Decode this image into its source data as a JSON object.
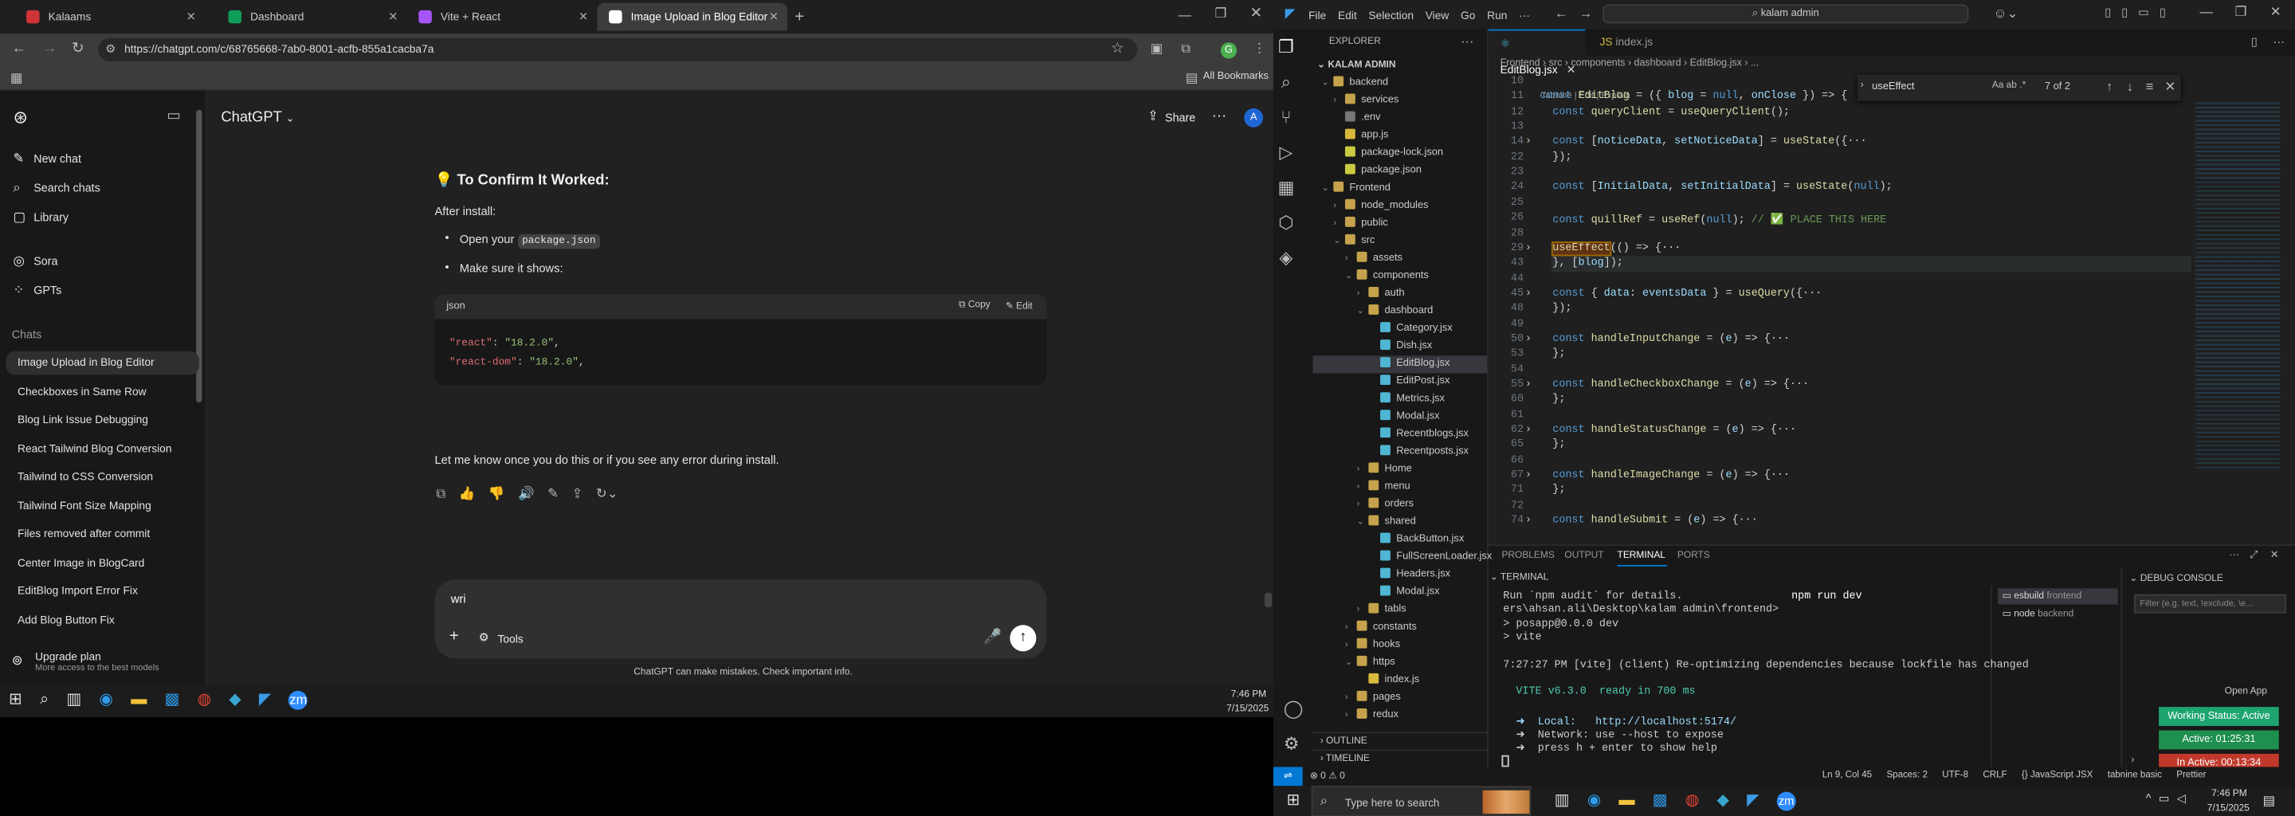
{
  "browser": {
    "tabs": [
      {
        "label": "Kalaams",
        "active": false,
        "color": "#d13438"
      },
      {
        "label": "Dashboard",
        "active": false,
        "color": "#0f9d58"
      },
      {
        "label": "Vite + React",
        "active": false,
        "color": "#a855f7"
      },
      {
        "label": "Image Upload in Blog Editor",
        "active": true,
        "color": "#ffffff"
      }
    ],
    "url": "https://chatgpt.com/c/68765668-7ab0-8001-acfb-855a1cacba7a",
    "all_bookmarks": "All Bookmarks",
    "profile_initial": "G"
  },
  "sidebar": {
    "new_chat": "New chat",
    "search_chats": "Search chats",
    "library": "Library",
    "sora": "Sora",
    "gpts": "GPTs",
    "chats_heading": "Chats",
    "chats": [
      "Image Upload in Blog Editor",
      "Checkboxes in Same Row",
      "Blog Link Issue Debugging",
      "React Tailwind Blog Conversion",
      "Tailwind to CSS Conversion",
      "Tailwind Font Size Mapping",
      "Files removed after commit",
      "Center Image in BlogCard",
      "EditBlog Import Error Fix",
      "Add Blog Button Fix"
    ],
    "upgrade_title": "Upgrade plan",
    "upgrade_sub": "More access to the best models"
  },
  "chat": {
    "model": "ChatGPT",
    "share": "Share",
    "avatar": "A",
    "heading": "💡 To Confirm It Worked:",
    "after_install": "After install:",
    "bullet1_prefix": "Open your",
    "bullet1_code": "package.json",
    "bullet2": "Make sure it shows:",
    "code_lang": "json",
    "copy": "Copy",
    "edit": "Edit",
    "code_line1_key": "\"react\"",
    "code_line1_val": "\"18.2.0\"",
    "code_line2_key": "\"react-dom\"",
    "code_line2_val": "\"18.2.0\"",
    "followup": "Let me know once you do this or if you see any error during install.",
    "input_value": "wri",
    "tools": "Tools",
    "disclaimer": "ChatGPT can make mistakes. Check important info."
  },
  "taskbar_left": {
    "time": "7:46 PM",
    "date": "7/15/2025"
  },
  "vscode": {
    "menu": [
      "File",
      "Edit",
      "Selection",
      "View",
      "Go",
      "Run",
      "···"
    ],
    "search": "kalam admin",
    "explorer_title": "EXPLORER",
    "root": "KALAM ADMIN",
    "tree": [
      {
        "label": "backend",
        "depth": 0,
        "type": "folder",
        "open": true
      },
      {
        "label": "services",
        "depth": 1,
        "type": "folder",
        "open": false
      },
      {
        "label": ".env",
        "depth": 1,
        "type": "env"
      },
      {
        "label": "app.js",
        "depth": 1,
        "type": "js"
      },
      {
        "label": "package-lock.json",
        "depth": 1,
        "type": "json"
      },
      {
        "label": "package.json",
        "depth": 1,
        "type": "json"
      },
      {
        "label": "Frontend",
        "depth": 0,
        "type": "folder",
        "open": true
      },
      {
        "label": "node_modules",
        "depth": 1,
        "type": "folder",
        "open": false
      },
      {
        "label": "public",
        "depth": 1,
        "type": "folder",
        "open": false
      },
      {
        "label": "src",
        "depth": 1,
        "type": "folder",
        "open": true
      },
      {
        "label": "assets",
        "depth": 2,
        "type": "folder",
        "open": false
      },
      {
        "label": "components",
        "depth": 2,
        "type": "folder",
        "open": true
      },
      {
        "label": "auth",
        "depth": 3,
        "type": "folder",
        "open": false
      },
      {
        "label": "dashboard",
        "depth": 3,
        "type": "folder",
        "open": true
      },
      {
        "label": "Category.jsx",
        "depth": 4,
        "type": "jsx"
      },
      {
        "label": "Dish.jsx",
        "depth": 4,
        "type": "jsx"
      },
      {
        "label": "EditBlog.jsx",
        "depth": 4,
        "type": "jsx",
        "selected": true
      },
      {
        "label": "EditPost.jsx",
        "depth": 4,
        "type": "jsx"
      },
      {
        "label": "Metrics.jsx",
        "depth": 4,
        "type": "jsx"
      },
      {
        "label": "Modal.jsx",
        "depth": 4,
        "type": "jsx"
      },
      {
        "label": "Recentblogs.jsx",
        "depth": 4,
        "type": "jsx"
      },
      {
        "label": "Recentposts.jsx",
        "depth": 4,
        "type": "jsx"
      },
      {
        "label": "Home",
        "depth": 3,
        "type": "folder",
        "open": false
      },
      {
        "label": "menu",
        "depth": 3,
        "type": "folder",
        "open": false
      },
      {
        "label": "orders",
        "depth": 3,
        "type": "folder",
        "open": false
      },
      {
        "label": "shared",
        "depth": 3,
        "type": "folder",
        "open": true
      },
      {
        "label": "BackButton.jsx",
        "depth": 4,
        "type": "jsx"
      },
      {
        "label": "FullScreenLoader.jsx",
        "depth": 4,
        "type": "jsx"
      },
      {
        "label": "Headers.jsx",
        "depth": 4,
        "type": "jsx"
      },
      {
        "label": "Modal.jsx",
        "depth": 4,
        "type": "jsx"
      },
      {
        "label": "tabls",
        "depth": 3,
        "type": "folder",
        "open": false
      },
      {
        "label": "constants",
        "depth": 2,
        "type": "folder",
        "open": false
      },
      {
        "label": "hooks",
        "depth": 2,
        "type": "folder",
        "open": false
      },
      {
        "label": "https",
        "depth": 2,
        "type": "folder",
        "open": true
      },
      {
        "label": "index.js",
        "depth": 3,
        "type": "js"
      },
      {
        "label": "pages",
        "depth": 2,
        "type": "folder",
        "open": false
      },
      {
        "label": "redux",
        "depth": 2,
        "type": "folder",
        "open": false
      }
    ],
    "outline": "OUTLINE",
    "timeline": "TIMELINE",
    "tabs": [
      "EditBlog.jsx",
      "index.js"
    ],
    "breadcrumb": "Frontend › src › components › dashboard › EditBlog.jsx › ...",
    "codelens": "Tabnine | Edit | Explain",
    "find_value": "useEffect",
    "find_count": "7 of 2",
    "lines": [
      {
        "n": "10",
        "t": ""
      },
      {
        "n": "11",
        "t": "const EditBlog = ({ blog = null, onClose }) => {"
      },
      {
        "n": "12",
        "t": "  const queryClient = useQueryClient();"
      },
      {
        "n": "13",
        "t": ""
      },
      {
        "n": "14",
        "t": "  const [noticeData, setNoticeData] = useState({···"
      },
      {
        "n": "22",
        "t": "  });"
      },
      {
        "n": "23",
        "t": ""
      },
      {
        "n": "24",
        "t": "  const [InitialData, setInitialData] = useState(null);"
      },
      {
        "n": "25",
        "t": ""
      },
      {
        "n": "26",
        "t": "  const quillRef = useRef(null); // ✅ PLACE THIS HERE"
      },
      {
        "n": "28",
        "t": ""
      },
      {
        "n": "29",
        "t": "  useEffect(() => {···"
      },
      {
        "n": "43",
        "t": "  }, [blog]);"
      },
      {
        "n": "44",
        "t": ""
      },
      {
        "n": "45",
        "t": "  const { data: eventsData } = useQuery({···"
      },
      {
        "n": "48",
        "t": "  });"
      },
      {
        "n": "49",
        "t": ""
      },
      {
        "n": "50",
        "t": "  const handleInputChange = (e) => {···"
      },
      {
        "n": "53",
        "t": "  };"
      },
      {
        "n": "54",
        "t": ""
      },
      {
        "n": "55",
        "t": "  const handleCheckboxChange = (e) => {···"
      },
      {
        "n": "60",
        "t": "  };"
      },
      {
        "n": "61",
        "t": ""
      },
      {
        "n": "62",
        "t": "  const handleStatusChange = (e) => {···"
      },
      {
        "n": "65",
        "t": "  };"
      },
      {
        "n": "66",
        "t": ""
      },
      {
        "n": "67",
        "t": "  const handleImageChange = (e) => {···"
      },
      {
        "n": "71",
        "t": "  };"
      },
      {
        "n": "72",
        "t": ""
      },
      {
        "n": "74",
        "t": "  const handleSubmit = (e) => {···"
      }
    ],
    "panel_tabs": [
      "PROBLEMS",
      "OUTPUT",
      "TERMINAL",
      "PORTS"
    ],
    "terminal_title": "TERMINAL",
    "terminal_lines": [
      "Run `npm audit` for details.",
      "ers\\ahsan.ali\\Desktop\\kalam admin\\frontend>",
      "> posapp@0.0.0 dev",
      "> vite",
      "",
      "7:27:27 PM [vite] (client) Re-optimizing dependencies because lockfile has changed",
      "",
      "  VITE v6.3.0  ready in 700 ms",
      "",
      "  ➜  Local:   http://localhost:5174/",
      "  ➜  Network: use --host to expose",
      "  ➜  press h + enter to show help"
    ],
    "npm_cmd": "npm run dev",
    "terminals": [
      {
        "name": "esbuild",
        "cwd": "frontend"
      },
      {
        "name": "node",
        "cwd": "backend"
      }
    ],
    "debug_console": "DEBUG CONSOLE",
    "debug_filter": "Filter (e.g. text, !exclude, \\e...",
    "open_app": "Open App",
    "working_status": "Working Status: Active",
    "active_time": "Active: 01:25:31",
    "inactive_time": "In Active: 00:13:34",
    "status_left": "⊗ 0 ⚠ 0",
    "status_right": [
      "Ln 9, Col 45",
      "Spaces: 2",
      "UTF-8",
      "CRLF",
      "{} JavaScript JSX",
      "tabnine basic",
      "Prettier"
    ]
  },
  "taskbar_right": {
    "search_placeholder": "Type here to search",
    "time": "7:46 PM",
    "date": "7/15/2025"
  }
}
